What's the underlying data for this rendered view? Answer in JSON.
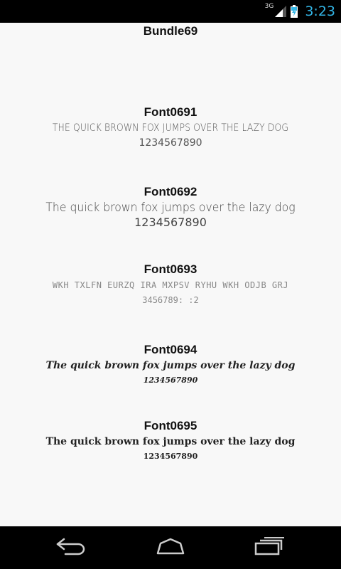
{
  "status_bar": {
    "network_type": "3G",
    "time": "3:23",
    "clock_color": "#33b5e5",
    "icons": [
      "signal-icon",
      "battery-charging-icon"
    ]
  },
  "bundle_title": "Bundle69",
  "fonts": [
    {
      "name": "Font0691",
      "sample": "THE QUICK BROWN FOX JUMPS OVER THE LAZY DOG",
      "digits": "1234567890"
    },
    {
      "name": "Font0692",
      "sample": "The quick brown fox jumps over the lazy dog",
      "digits": "1234567890"
    },
    {
      "name": "Font0693",
      "sample": "WKH TXLFN EURZQ IRA MXPSV RYHU WKH ODJB GRJ",
      "digits": "3456789: :2"
    },
    {
      "name": "Font0694",
      "sample": "The quick brown fox jumps over the lazy dog",
      "digits": "1234567890"
    },
    {
      "name": "Font0695",
      "sample": "The quick brown fox jumps over the lazy dog",
      "digits": "1234567890"
    }
  ],
  "nav_bar": {
    "icons": [
      "back-icon",
      "home-icon",
      "recent-apps-icon"
    ]
  }
}
